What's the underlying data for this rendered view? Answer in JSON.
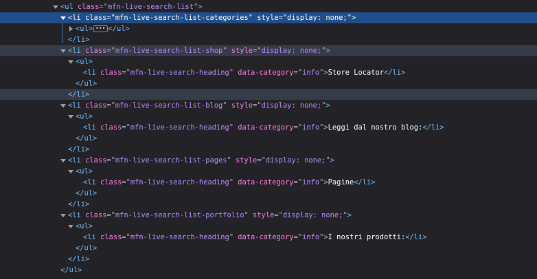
{
  "panel": "Inspector markup view",
  "lines": [
    {
      "indent": 0,
      "twisty": "down",
      "kind": "open",
      "tag": "ul",
      "attrs": [
        {
          "name": "class",
          "value": "mfn-live-search-list"
        }
      ]
    },
    {
      "indent": 1,
      "twisty": "down",
      "kind": "open",
      "tag": "li",
      "attrs": [
        {
          "name": "class",
          "value": "mfn-live-search-list-categories"
        },
        {
          "name": "style",
          "value": "display: none;"
        }
      ],
      "state": "selected"
    },
    {
      "indent": 2,
      "twisty": "right",
      "kind": "collapsed",
      "tag": "ul",
      "ellipsis": "•••"
    },
    {
      "indent": 1,
      "twisty": "none",
      "kind": "close",
      "tag": "li"
    },
    {
      "indent": 1,
      "twisty": "down",
      "kind": "open",
      "tag": "li",
      "attrs": [
        {
          "name": "class",
          "value": "mfn-live-search-list-shop"
        },
        {
          "name": "style",
          "value": "display: none;"
        }
      ],
      "state": "hover"
    },
    {
      "indent": 2,
      "twisty": "down",
      "kind": "open",
      "tag": "ul",
      "attrs": []
    },
    {
      "indent": 3,
      "twisty": "none",
      "kind": "element",
      "tag": "li",
      "attrs": [
        {
          "name": "class",
          "value": "mfn-live-search-heading"
        },
        {
          "name": "data-category",
          "value": "info"
        }
      ],
      "text": "Store Locator"
    },
    {
      "indent": 2,
      "twisty": "none",
      "kind": "close",
      "tag": "ul"
    },
    {
      "indent": 1,
      "twisty": "none",
      "kind": "close",
      "tag": "li",
      "state": "hover"
    },
    {
      "indent": 1,
      "twisty": "down",
      "kind": "open",
      "tag": "li",
      "attrs": [
        {
          "name": "class",
          "value": "mfn-live-search-list-blog"
        },
        {
          "name": "style",
          "value": "display: none;"
        }
      ]
    },
    {
      "indent": 2,
      "twisty": "down",
      "kind": "open",
      "tag": "ul",
      "attrs": []
    },
    {
      "indent": 3,
      "twisty": "none",
      "kind": "element",
      "tag": "li",
      "attrs": [
        {
          "name": "class",
          "value": "mfn-live-search-heading"
        },
        {
          "name": "data-category",
          "value": "info"
        }
      ],
      "text": "Leggi dal nostro blog:"
    },
    {
      "indent": 2,
      "twisty": "none",
      "kind": "close",
      "tag": "ul"
    },
    {
      "indent": 1,
      "twisty": "none",
      "kind": "close",
      "tag": "li"
    },
    {
      "indent": 1,
      "twisty": "down",
      "kind": "open",
      "tag": "li",
      "attrs": [
        {
          "name": "class",
          "value": "mfn-live-search-list-pages"
        },
        {
          "name": "style",
          "value": "display: none;"
        }
      ]
    },
    {
      "indent": 2,
      "twisty": "down",
      "kind": "open",
      "tag": "ul",
      "attrs": []
    },
    {
      "indent": 3,
      "twisty": "none",
      "kind": "element",
      "tag": "li",
      "attrs": [
        {
          "name": "class",
          "value": "mfn-live-search-heading"
        },
        {
          "name": "data-category",
          "value": "info"
        }
      ],
      "text": "Pagine"
    },
    {
      "indent": 2,
      "twisty": "none",
      "kind": "close",
      "tag": "ul"
    },
    {
      "indent": 1,
      "twisty": "none",
      "kind": "close",
      "tag": "li"
    },
    {
      "indent": 1,
      "twisty": "down",
      "kind": "open",
      "tag": "li",
      "attrs": [
        {
          "name": "class",
          "value": "mfn-live-search-list-portfolio"
        },
        {
          "name": "style",
          "value": "display: none;"
        }
      ]
    },
    {
      "indent": 2,
      "twisty": "down",
      "kind": "open",
      "tag": "ul",
      "attrs": []
    },
    {
      "indent": 3,
      "twisty": "none",
      "kind": "element",
      "tag": "li",
      "attrs": [
        {
          "name": "class",
          "value": "mfn-live-search-heading"
        },
        {
          "name": "data-category",
          "value": "info"
        }
      ],
      "text": "I nostri prodotti:"
    },
    {
      "indent": 2,
      "twisty": "none",
      "kind": "close",
      "tag": "ul"
    },
    {
      "indent": 1,
      "twisty": "none",
      "kind": "close",
      "tag": "li"
    },
    {
      "indent": 0,
      "twisty": "none",
      "kind": "close",
      "tag": "ul"
    }
  ]
}
